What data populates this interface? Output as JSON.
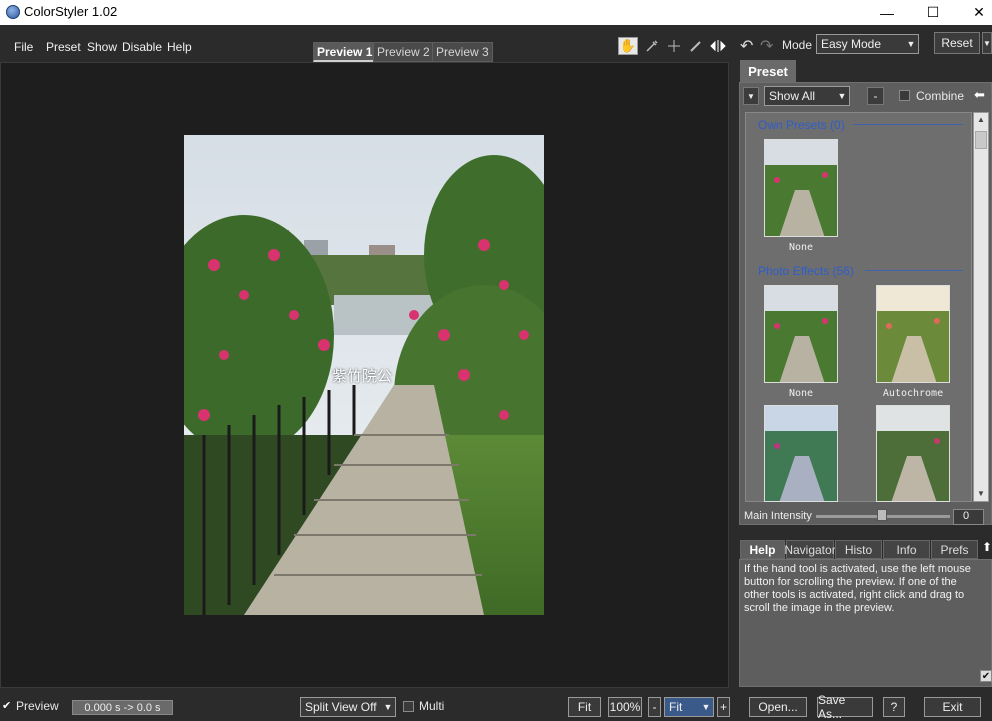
{
  "window": {
    "title": "ColorStyler 1.02",
    "minimize": "—",
    "maximize": "☐",
    "close": "✕"
  },
  "menu": [
    "File",
    "Preset",
    "Show",
    "Disable",
    "Help"
  ],
  "preview_tabs": [
    "Preview 1",
    "Preview 2",
    "Preview 3"
  ],
  "toolbar": {
    "mode_label": "Mode",
    "mode_value": "Easy Mode",
    "reset": "Reset"
  },
  "photo": {
    "watermark": "紫竹院公"
  },
  "preset_panel": {
    "tab": "Preset",
    "filter_value": "Show All",
    "minus": "-",
    "combine_label": "Combine",
    "categories": [
      {
        "title": "Own Presets (0)",
        "items": [
          "None"
        ]
      },
      {
        "title": "Photo Effects (56)",
        "items": [
          "None",
          "Autochrome",
          "",
          ""
        ]
      }
    ],
    "intensity_label": "Main Intensity",
    "intensity_value": "0"
  },
  "help_panel": {
    "tabs": [
      "Help",
      "Navigator",
      "Histo",
      "Info",
      "Prefs"
    ],
    "text": "If the hand tool is activated, use the left mouse button for scrolling the preview. If one of the other tools is activated, right click and drag to scroll the image in the preview."
  },
  "bottom": {
    "preview_label": "Preview",
    "timing": "0.000 s -> 0.0 s",
    "split_view": "Split View Off",
    "multi_label": "Multi",
    "fit_button": "Fit",
    "zoom_value": "100%",
    "zoom_minus": "-",
    "zoom_select": "Fit",
    "zoom_plus": "+",
    "open": "Open...",
    "save_as": "Save As...",
    "help": "?",
    "exit": "Exit"
  }
}
